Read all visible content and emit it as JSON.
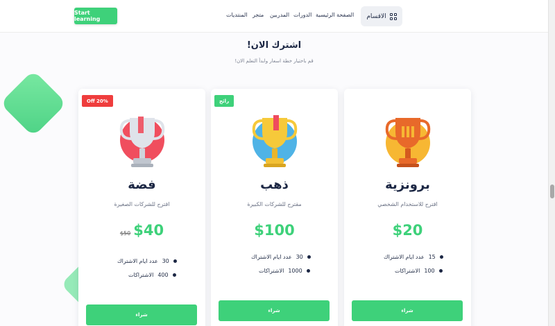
{
  "header": {
    "start_button": "Start learning",
    "nav": [
      "المنتديات",
      "متجر",
      "المدربين",
      "الدورات",
      "الصفحة الرئيسية"
    ],
    "categories_button": "الاقسام"
  },
  "section": {
    "title": "اشترك الان!",
    "subtitle": "قم باختيار خطة اسعار وابدأ التعلم الان!"
  },
  "plans": [
    {
      "badge": "Off 20%",
      "badge_color": "#ef3d3d",
      "icon": "silver-trophy-icon",
      "name": "فضة",
      "description": "اقترح للشركات الصغيرة",
      "price": "$40",
      "old_price": "$50",
      "features": [
        {
          "value": "30",
          "label": "عدد ايام الاشتراك"
        },
        {
          "value": "400",
          "label": "الاشتراكات"
        }
      ],
      "button": "شراء"
    },
    {
      "badge": "رائج",
      "badge_color": "#3ed17a",
      "icon": "gold-trophy-icon",
      "name": "ذهب",
      "description": "مقترح للشركات الكبيرة",
      "price": "$100",
      "old_price": "",
      "features": [
        {
          "value": "30",
          "label": "عدد ايام الاشتراك"
        },
        {
          "value": "1000",
          "label": "الاشتراكات"
        }
      ],
      "button": "شراء"
    },
    {
      "badge": "",
      "badge_color": "",
      "icon": "bronze-trophy-icon",
      "name": "برونزية",
      "description": "اقترح للاستخدام الشخصي",
      "price": "$20",
      "old_price": "",
      "features": [
        {
          "value": "15",
          "label": "عدد ايام الاشتراك"
        },
        {
          "value": "100",
          "label": "الاشتراكات"
        }
      ],
      "button": "شراء"
    }
  ],
  "colors": {
    "accent": "#3ed17a",
    "danger": "#ef3d3d",
    "heading": "#1c2744"
  }
}
